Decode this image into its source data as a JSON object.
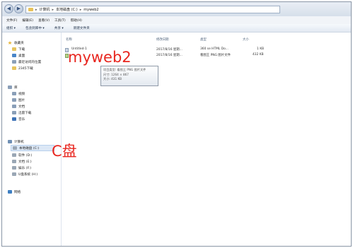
{
  "address_bar": {
    "crumbs": [
      "计算机",
      "本地磁盘 (C:)",
      "myweb2"
    ],
    "separator": "▸"
  },
  "menu": [
    "文件(F)",
    "编辑(E)",
    "查看(V)",
    "工具(T)",
    "帮助(H)"
  ],
  "toolbar": [
    "组织 ▾",
    "包含到库中 ▾",
    "共享 ▾",
    "新建文件夹"
  ],
  "navigation": {
    "favorites": {
      "label": "收藏夹",
      "items": [
        "下载",
        "桌面",
        "最近访问的位置",
        "2345下载"
      ]
    },
    "libraries": {
      "label": "库",
      "items": [
        "视频",
        "图片",
        "文档",
        "迅雷下载",
        "音乐"
      ]
    },
    "computer": {
      "label": "计算机",
      "items": [
        "本地磁盘 (C:)",
        "软件 (D:)",
        "文档 (E:)",
        "娱乐 (F:)",
        "U盘系统 (H:)"
      ]
    },
    "network": {
      "label": "网络"
    }
  },
  "columns": [
    "名称",
    "修改日期",
    "类型",
    "大小"
  ],
  "files": [
    {
      "name": "Untitled-1",
      "date": "2017/8/16 星期...",
      "type": "360 se HTML Do...",
      "size": "1 KB"
    },
    {
      "name": "",
      "date": "2017/8/16 星期...",
      "type": "看图王 PNG 图片文件",
      "size": "432 KB"
    }
  ],
  "tooltip": [
    "项目类型: 看图王 PNG 图片文件",
    "尺寸: 1264 × 867",
    "大小: 431 KB"
  ],
  "annotations": {
    "folder_name": "myweb2",
    "drive": "C盘"
  },
  "colors": {
    "annotation": "#e8261f",
    "selection": "#dce8f6"
  }
}
